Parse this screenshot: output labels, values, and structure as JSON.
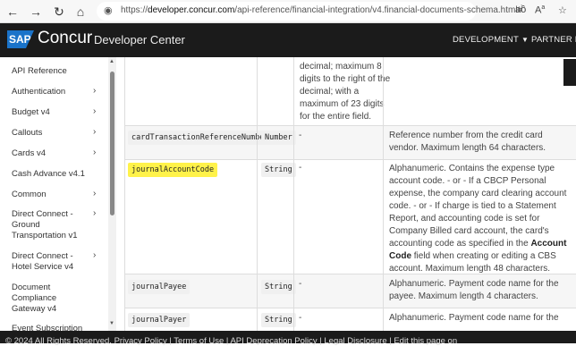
{
  "browser": {
    "url_prefix": "https://",
    "url_host": "developer.concur.com",
    "url_path": "/api-reference/financial-integration/v4.financial-documents-schema.html#"
  },
  "header": {
    "logo_text": "SAP",
    "brand": "Concur",
    "subtitle": "Developer Center",
    "nav": [
      {
        "label": "DEVELOPMENT"
      },
      {
        "label": "PARTNER RE"
      }
    ]
  },
  "sidebar": {
    "items": [
      {
        "label": "API Reference",
        "has_children": false
      },
      {
        "label": "Authentication",
        "has_children": true
      },
      {
        "label": "Budget v4",
        "has_children": true
      },
      {
        "label": "Callouts",
        "has_children": true
      },
      {
        "label": "Cards v4",
        "has_children": true
      },
      {
        "label": "Cash Advance v4.1",
        "has_children": false
      },
      {
        "label": "Common",
        "has_children": true
      },
      {
        "label": "Direct Connect - Ground Transportation v1",
        "has_children": true
      },
      {
        "label": "Direct Connect - Hotel Service v4",
        "has_children": true
      },
      {
        "label": "Document Compliance Gateway v4",
        "has_children": false
      },
      {
        "label": "Event Subscription",
        "has_children": false
      }
    ]
  },
  "table": {
    "rows": [
      {
        "name": "",
        "type": "",
        "required": "",
        "description": "decimal; maximum 8 digits to the right of the decimal; with a maximum of 23 digits for the entire field."
      },
      {
        "name": "cardTransactionReferenceNumber",
        "type": "Number",
        "required": "-",
        "description": "Reference number from the credit card vendor. Maximum length 64 characters."
      },
      {
        "name": "journalAccountCode",
        "type": "String",
        "required": "-",
        "description_pre": "Alphanumeric. Contains the expense type account code. - or - If a CBCP Personal expense, the company card clearing account code. - or - If charge is tied to a Statement Report, and accounting code is set for Company Billed card account, the card's accounting code as specified in the ",
        "description_bold": "Account Code",
        "description_post": " field when creating or editing a CBS account. Maximum length 48 characters."
      },
      {
        "name": "journalPayee",
        "type": "String",
        "required": "-",
        "description": "Alphanumeric. Payment code name for the payee. Maximum length 4 characters."
      },
      {
        "name": "journalPayer",
        "type": "String",
        "required": "-",
        "description": "Alphanumeric. Payment code name for the"
      }
    ]
  },
  "footer": {
    "text": "© 2024 All Rights Reserved. Privacy Policy | Terms of Use | API Deprecation Policy | Legal Disclosure | Edit this page on"
  },
  "colors": {
    "header_bg": "#1b1b1b",
    "highlight": "#fff24a",
    "sap_blue": "#1a73c9"
  }
}
